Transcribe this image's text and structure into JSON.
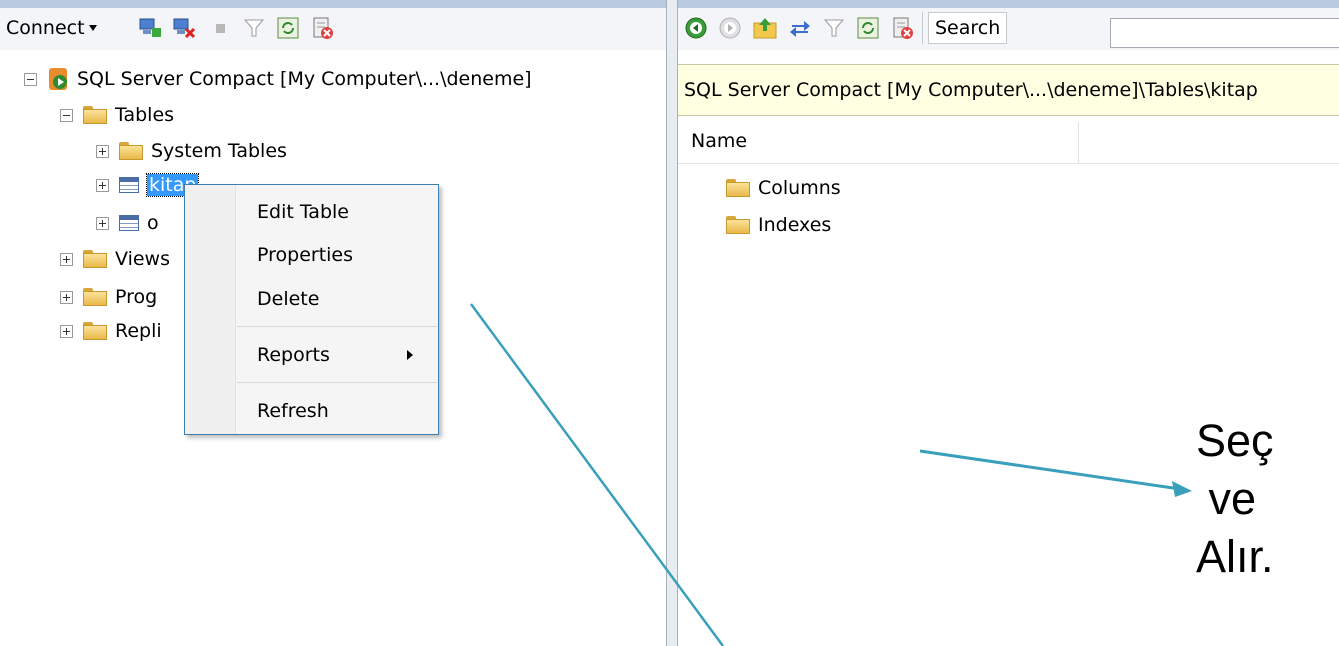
{
  "left_toolbar": {
    "connect_label": "Connect",
    "icons": [
      "connect-db-icon",
      "disconnect-db-icon",
      "stop-icon",
      "filter-icon",
      "refresh-icon",
      "object-explorer-icon"
    ]
  },
  "tree": {
    "root": "SQL Server Compact [My Computer\\...\\deneme]",
    "tables": "Tables",
    "system_tables": "System Tables",
    "kitap": "kitap",
    "second_table": "o",
    "views": "Views",
    "programmability": "Prog",
    "replication": "Repli"
  },
  "context_menu": {
    "edit_table": "Edit Table",
    "properties": "Properties",
    "delete": "Delete",
    "reports": "Reports",
    "refresh": "Refresh"
  },
  "right_toolbar": {
    "search_label": "Search",
    "search_value": ""
  },
  "path_bar": "SQL Server Compact [My Computer\\...\\deneme]\\Tables\\kitap",
  "list": {
    "header_name": "Name",
    "items": [
      "Columns",
      "Indexes"
    ]
  },
  "annotation": {
    "line1": "Seç",
    "line2": " ve",
    "line3": "Alır."
  },
  "colors": {
    "arrow": "#3a9fba",
    "selection": "#3399ff",
    "path_bar_bg": "#ffffe1"
  }
}
